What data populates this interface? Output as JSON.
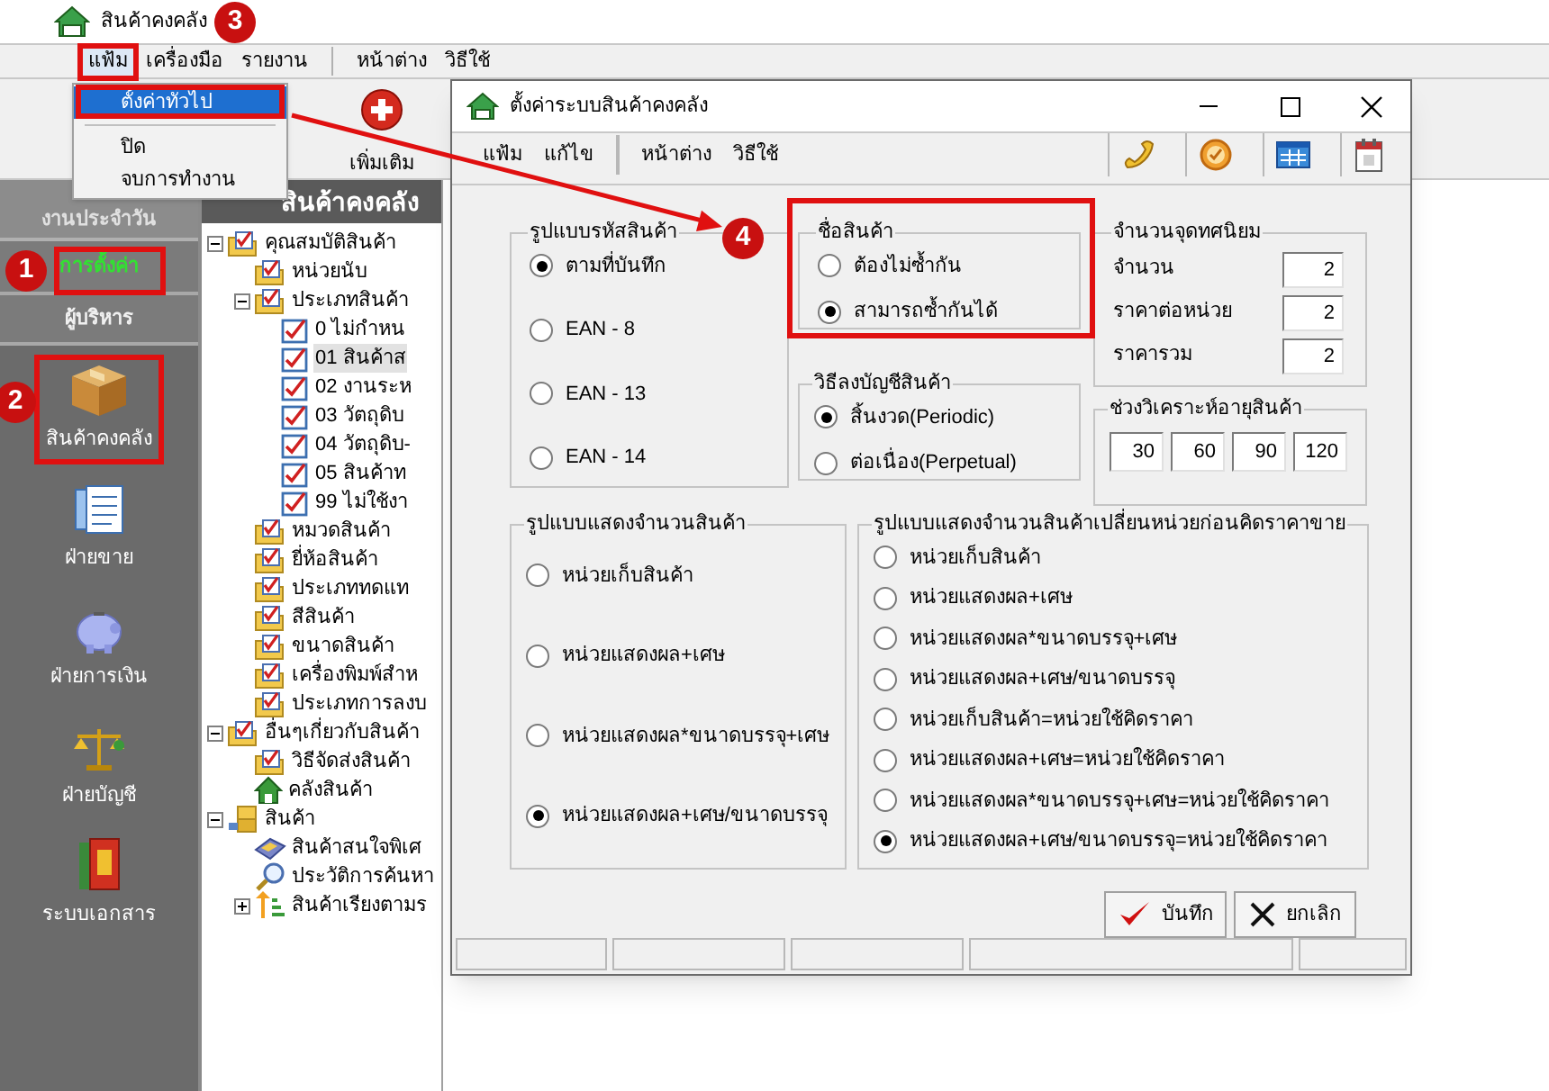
{
  "window": {
    "title": "สินค้าคงคลัง"
  },
  "menu": [
    {
      "label": "แฟ้ม",
      "selected": true
    },
    {
      "label": "เครื่องมือ",
      "selected": false
    },
    {
      "label": "รายงาน",
      "selected": false
    },
    {
      "label": "หน้าต่าง",
      "selected": false
    },
    {
      "label": "วิธีใช้",
      "selected": false
    }
  ],
  "file_menu": [
    {
      "label": "ตั้งค่าทั่วไป",
      "selected": true
    },
    {
      "label": "ปิด",
      "selected": false
    },
    {
      "label": "จบการทำงาน",
      "selected": false
    }
  ],
  "toolbar": [
    {
      "label": "เพิ่มเติม"
    }
  ],
  "sidebar": {
    "header": "งานประจำวัน",
    "tabs": [
      {
        "label": "การตั้งค่า",
        "selected": true
      },
      {
        "label": "ผู้บริหาร",
        "selected": false
      }
    ],
    "items": [
      {
        "label": "สินค้าคงคลัง"
      },
      {
        "label": "ฝ่ายขาย"
      },
      {
        "label": "ฝ่ายการเงิน"
      },
      {
        "label": "ฝ่ายบัญชี"
      },
      {
        "label": "ระบบเอกสาร"
      }
    ]
  },
  "tree": {
    "header": "สินค้าคงคลัง",
    "nodes": [
      {
        "label": "คุณสมบัติสินค้า",
        "kind": "folder",
        "expanded": true,
        "selected": false,
        "children": [
          {
            "label": "หน่วยนับ",
            "kind": "folder",
            "selected": false
          },
          {
            "label": "ประเภทสินค้า",
            "kind": "folder",
            "expanded": true,
            "selected": false,
            "children": [
              {
                "label": "0 ไม่กำหน",
                "kind": "document",
                "selected": false
              },
              {
                "label": "01 สินค้าส",
                "kind": "document",
                "selected": true
              },
              {
                "label": "02 งานระห",
                "kind": "document",
                "selected": false
              },
              {
                "label": "03 วัตถุดิบ",
                "kind": "document",
                "selected": false
              },
              {
                "label": "04 วัตถุดิบ-",
                "kind": "document",
                "selected": false
              },
              {
                "label": "05 สินค้าท",
                "kind": "document",
                "selected": false
              },
              {
                "label": "99 ไม่ใช้งา",
                "kind": "document",
                "selected": false
              }
            ]
          },
          {
            "label": "หมวดสินค้า",
            "kind": "folder",
            "selected": false
          },
          {
            "label": "ยี่ห้อสินค้า",
            "kind": "folder",
            "selected": false
          },
          {
            "label": "ประเภททดแท",
            "kind": "folder",
            "selected": false
          },
          {
            "label": "สีสินค้า",
            "kind": "folder",
            "selected": false
          },
          {
            "label": "ขนาดสินค้า",
            "kind": "folder",
            "selected": false
          },
          {
            "label": "เครื่องพิมพ์สำห",
            "kind": "folder",
            "selected": false
          },
          {
            "label": "ประเภทการลงบ",
            "kind": "folder",
            "selected": false
          }
        ]
      },
      {
        "label": "อื่นๆเกี่ยวกับสินค้า",
        "kind": "folder",
        "expanded": true,
        "selected": false,
        "children": [
          {
            "label": "วิธีจัดส่งสินค้า",
            "kind": "folder",
            "selected": false
          },
          {
            "label": "คลังสินค้า",
            "kind": "warehouse",
            "selected": false
          }
        ]
      },
      {
        "label": "สินค้า",
        "kind": "product",
        "expanded": true,
        "selected": false,
        "children": [
          {
            "label": "สินค้าสนใจพิเศ",
            "kind": "favorite",
            "selected": false
          },
          {
            "label": "ประวัติการค้นหา",
            "kind": "history",
            "selected": false
          },
          {
            "label": "สินค้าเรียงตามร",
            "kind": "ranking",
            "expanded": false,
            "selected": false
          }
        ]
      }
    ]
  },
  "dialog": {
    "title": "ตั้งค่าระบบสินค้าคงคลัง",
    "menu": [
      "แฟ้ม",
      "แก้ไข",
      "หน้าต่าง",
      "วิธีใช้"
    ],
    "code_format": {
      "title": "รูปแบบรหัสสินค้า",
      "options": [
        {
          "label": "ตามที่บันทึก",
          "selected": true
        },
        {
          "label": "EAN - 8",
          "selected": false
        },
        {
          "label": "EAN - 13",
          "selected": false
        },
        {
          "label": "EAN - 14",
          "selected": false
        }
      ]
    },
    "product_name": {
      "title": "ชื่อสินค้า",
      "options": [
        {
          "label": "ต้องไม่ซ้ำกัน",
          "selected": false
        },
        {
          "label": "สามารถซ้ำกันได้",
          "selected": true
        }
      ]
    },
    "decimals": {
      "title": "จำนวนจุดทศนิยม",
      "fields": [
        {
          "label": "จำนวน",
          "value": "2"
        },
        {
          "label": "ราคาต่อหน่วย",
          "value": "2"
        },
        {
          "label": "ราคารวม",
          "value": "2"
        }
      ]
    },
    "accounting": {
      "title": "วิธีลงบัญชีสินค้า",
      "options": [
        {
          "label": "สิ้นงวด(Periodic)",
          "selected": true
        },
        {
          "label": "ต่อเนื่อง(Perpetual)",
          "selected": false
        }
      ]
    },
    "aging": {
      "title": "ช่วงวิเคราะห์อายุสินค้า",
      "values": [
        "30",
        "60",
        "90",
        "120"
      ]
    },
    "quantity_display": {
      "title": "รูปแบบแสดงจำนวนสินค้า",
      "options": [
        {
          "label": "หน่วยเก็บสินค้า",
          "selected": false
        },
        {
          "label": "หน่วยแสดงผล+เศษ",
          "selected": false
        },
        {
          "label": "หน่วยแสดงผล*ขนาดบรรจุ+เศษ",
          "selected": false
        },
        {
          "label": "หน่วยแสดงผล+เศษ/ขนาดบรรจุ",
          "selected": true
        }
      ]
    },
    "conversion_display": {
      "title": "รูปแบบแสดงจำนวนสินค้าเปลี่ยนหน่วยก่อนคิดราคาขาย",
      "options": [
        {
          "label": "หน่วยเก็บสินค้า",
          "selected": false
        },
        {
          "label": "หน่วยแสดงผล+เศษ",
          "selected": false
        },
        {
          "label": "หน่วยแสดงผล*ขนาดบรรจุ+เศษ",
          "selected": false
        },
        {
          "label": "หน่วยแสดงผล+เศษ/ขนาดบรรจุ",
          "selected": false
        },
        {
          "label": "หน่วยเก็บสินค้า=หน่วยใช้คิดราคา",
          "selected": false
        },
        {
          "label": "หน่วยแสดงผล+เศษ=หน่วยใช้คิดราคา",
          "selected": false
        },
        {
          "label": "หน่วยแสดงผล*ขนาดบรรจุ+เศษ=หน่วยใช้คิดราคา",
          "selected": false
        },
        {
          "label": "หน่วยแสดงผล+เศษ/ขนาดบรรจุ=หน่วยใช้คิดราคา",
          "selected": true
        }
      ]
    },
    "buttons": [
      {
        "label": "บันทึก"
      },
      {
        "label": "ยกเลิก"
      }
    ]
  },
  "annotations": [
    {
      "label": "1"
    },
    {
      "label": "2"
    },
    {
      "label": "3"
    },
    {
      "label": "4"
    }
  ]
}
